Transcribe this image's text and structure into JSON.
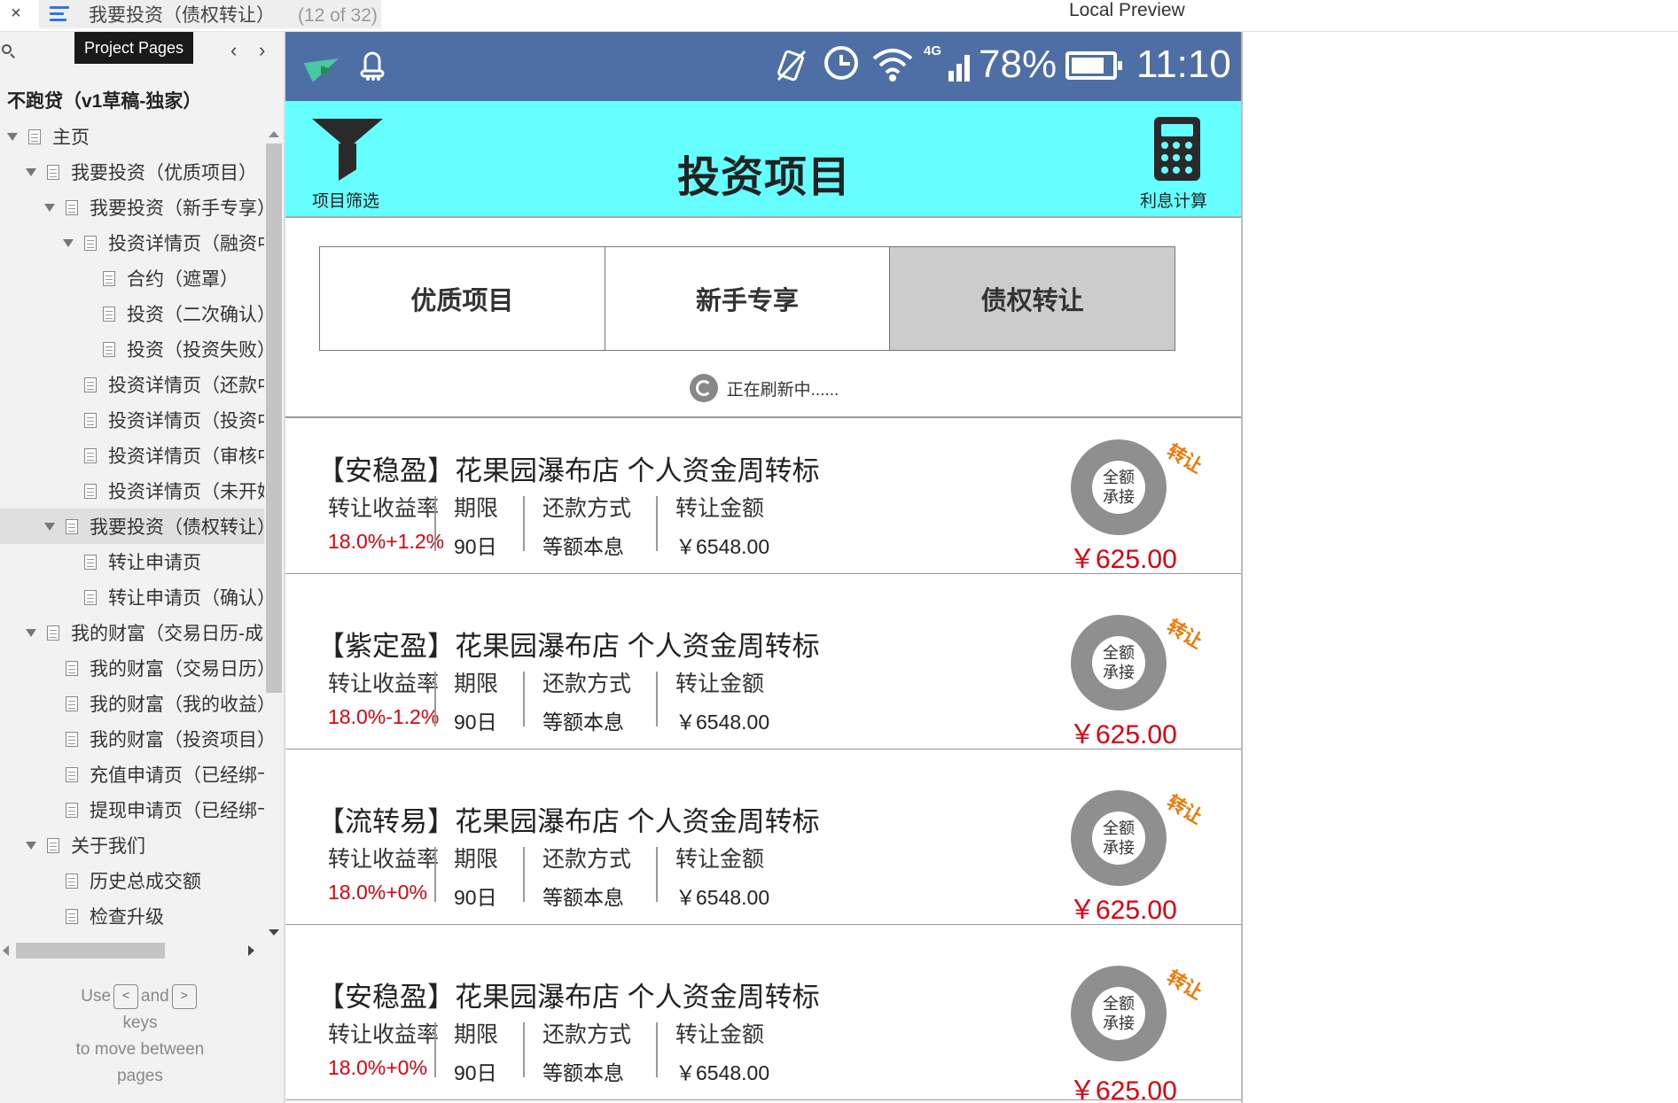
{
  "topbar": {
    "close": "×",
    "page_title": "我要投资（债权转让）",
    "page_count": "(12 of 32)",
    "preview_title": "Local Preview"
  },
  "sidebar": {
    "tooltip": "Project Pages",
    "prev": "‹",
    "next": "›",
    "project_name": "不跑贷（v1草稿-独家）",
    "tree": [
      {
        "label": "主页",
        "depth": 0,
        "expand": true,
        "selected": false
      },
      {
        "label": "我要投资（优质项目）",
        "depth": 1,
        "expand": true,
        "selected": false
      },
      {
        "label": "我要投资（新手专享）",
        "depth": 2,
        "expand": true,
        "selected": false
      },
      {
        "label": "投资详情页（融资中）",
        "depth": 3,
        "expand": true,
        "selected": false
      },
      {
        "label": "合约（遮罩）",
        "depth": 4,
        "expand": false,
        "selected": false
      },
      {
        "label": "投资（二次确认）",
        "depth": 4,
        "expand": false,
        "selected": false
      },
      {
        "label": "投资（投资失败）",
        "depth": 4,
        "expand": false,
        "selected": false
      },
      {
        "label": "投资详情页（还款中）",
        "depth": 3,
        "expand": false,
        "selected": false
      },
      {
        "label": "投资详情页（投资中）",
        "depth": 3,
        "expand": false,
        "selected": false
      },
      {
        "label": "投资详情页（审核中）",
        "depth": 3,
        "expand": false,
        "selected": false
      },
      {
        "label": "投资详情页（未开始）",
        "depth": 3,
        "expand": false,
        "selected": false
      },
      {
        "label": "我要投资（债权转让）",
        "depth": 2,
        "expand": true,
        "selected": true
      },
      {
        "label": "转让申请页",
        "depth": 3,
        "expand": false,
        "selected": false
      },
      {
        "label": "转让申请页（确认）",
        "depth": 3,
        "expand": false,
        "selected": false
      },
      {
        "label": "我的财富（交易日历-成功）",
        "depth": 1,
        "expand": true,
        "selected": false
      },
      {
        "label": "我的财富（交易日历）",
        "depth": 2,
        "expand": false,
        "selected": false
      },
      {
        "label": "我的财富（我的收益）",
        "depth": 2,
        "expand": false,
        "selected": false
      },
      {
        "label": "我的财富（投资项目）",
        "depth": 2,
        "expand": false,
        "selected": false
      },
      {
        "label": "充值申请页（已经绑卡）",
        "depth": 2,
        "expand": false,
        "selected": false
      },
      {
        "label": "提现申请页（已经绑卡）",
        "depth": 2,
        "expand": false,
        "selected": false
      },
      {
        "label": "关于我们",
        "depth": 1,
        "expand": true,
        "selected": false
      },
      {
        "label": "历史总成交额",
        "depth": 2,
        "expand": false,
        "selected": false
      },
      {
        "label": "检查升级",
        "depth": 2,
        "expand": false,
        "selected": false
      }
    ],
    "help": {
      "use": "Use",
      "key_prev": "<",
      "and": "and",
      "key_next": ">",
      "keys": "keys",
      "line2": "to move between",
      "line3": "pages"
    }
  },
  "phone": {
    "status": {
      "network": "4G",
      "battery": "78%",
      "time": "11:10"
    },
    "header": {
      "filter_label": "项目筛选",
      "title": "投资项目",
      "calc_label": "利息计算"
    },
    "tabs": [
      {
        "label": "优质项目",
        "active": false
      },
      {
        "label": "新手专享",
        "active": false
      },
      {
        "label": "债权转让",
        "active": true
      }
    ],
    "refresh_text": "正在刷新中......",
    "labels": {
      "rate": "转让收益率",
      "term": "期限",
      "repay": "还款方式",
      "amount": "转让金额",
      "badge_line1": "全额",
      "badge_line2": "承接",
      "tag": "转让"
    },
    "cards": [
      {
        "title": "【安稳盈】花果园瀑布店 个人资金周转标",
        "rate": "18.0%+1.2%",
        "term": "90日",
        "repay": "等额本息",
        "amount": "￥6548.00",
        "price": "￥625.00"
      },
      {
        "title": "【紫定盈】花果园瀑布店 个人资金周转标",
        "rate": "18.0%-1.2%",
        "term": "90日",
        "repay": "等额本息",
        "amount": "￥6548.00",
        "price": "￥625.00"
      },
      {
        "title": "【流转易】花果园瀑布店 个人资金周转标",
        "rate": "18.0%+0%",
        "term": "90日",
        "repay": "等额本息",
        "amount": "￥6548.00",
        "price": "￥625.00"
      },
      {
        "title": "【安稳盈】花果园瀑布店 个人资金周转标",
        "rate": "18.0%+0%",
        "term": "90日",
        "repay": "等额本息",
        "amount": "￥6548.00",
        "price": "￥625.00"
      }
    ]
  }
}
